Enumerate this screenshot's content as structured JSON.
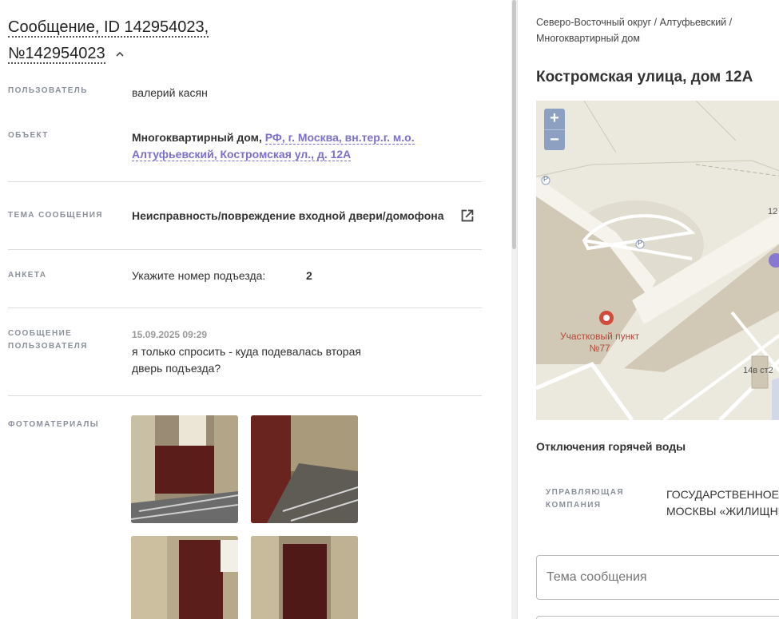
{
  "header": {
    "title_line1": "Сообщение, ID 142954023,",
    "title_line2": "№142954023"
  },
  "fields": {
    "user": {
      "label": "ПОЛЬЗОВАТЕЛЬ",
      "value": "валерий касян"
    },
    "object": {
      "label": "ОБЪЕКТ",
      "type": "Многоквартирный дом,",
      "address_link": "РФ, г. Москва, вн.тер.г. м.о. Алтуфьевский, Костромская ул., д. 12А"
    },
    "topic": {
      "label": "ТЕМА СООБЩЕНИЯ",
      "value": "Неисправность/повреждение входной двери/домофона"
    },
    "survey": {
      "label": "АНКЕТА",
      "question": "Укажите номер подъезда:",
      "answer": "2"
    },
    "message": {
      "label_line1": "СООБЩЕНИЕ",
      "label_line2": "ПОЛЬЗОВАТЕЛЯ",
      "date": "15.09.2025 09:29",
      "text_line1": "я только спросить - куда подевалась вторая",
      "text_line2": "дверь подъезда?"
    },
    "photos": {
      "label": "ФОТОМАТЕРИАЛЫ"
    }
  },
  "sidebar": {
    "breadcrumb_line1": "Северо-Восточный округ / Алтуфьевский /",
    "breadcrumb_line2": "Многоквартирный дом",
    "address": "Костромская улица, дом 12А",
    "map": {
      "zoom_in": "+",
      "zoom_out": "−",
      "poi_line1": "Участковый пункт",
      "poi_line2": "№77",
      "num_12": "12",
      "num_14v": "14в ст2",
      "parking": "P"
    },
    "hot_water": "Отключения горячей воды",
    "company": {
      "label_line1": "УПРАВЛЯЮЩАЯ",
      "label_line2": "КОМПАНИЯ",
      "value_line1": "ГОСУДАРСТВЕННОЕ Б",
      "value_line2": "МОСКВЫ «ЖИЛИЩНИ"
    },
    "topic_field_placeholder": "Тема сообщения"
  },
  "colors": {
    "link": "#7b6fc9",
    "label": "#8a8f99",
    "map_bg": "#ebe8dd",
    "map_building": "#cfc6b3",
    "zoom": "#8da0c2",
    "poi": "#b04a3a"
  }
}
